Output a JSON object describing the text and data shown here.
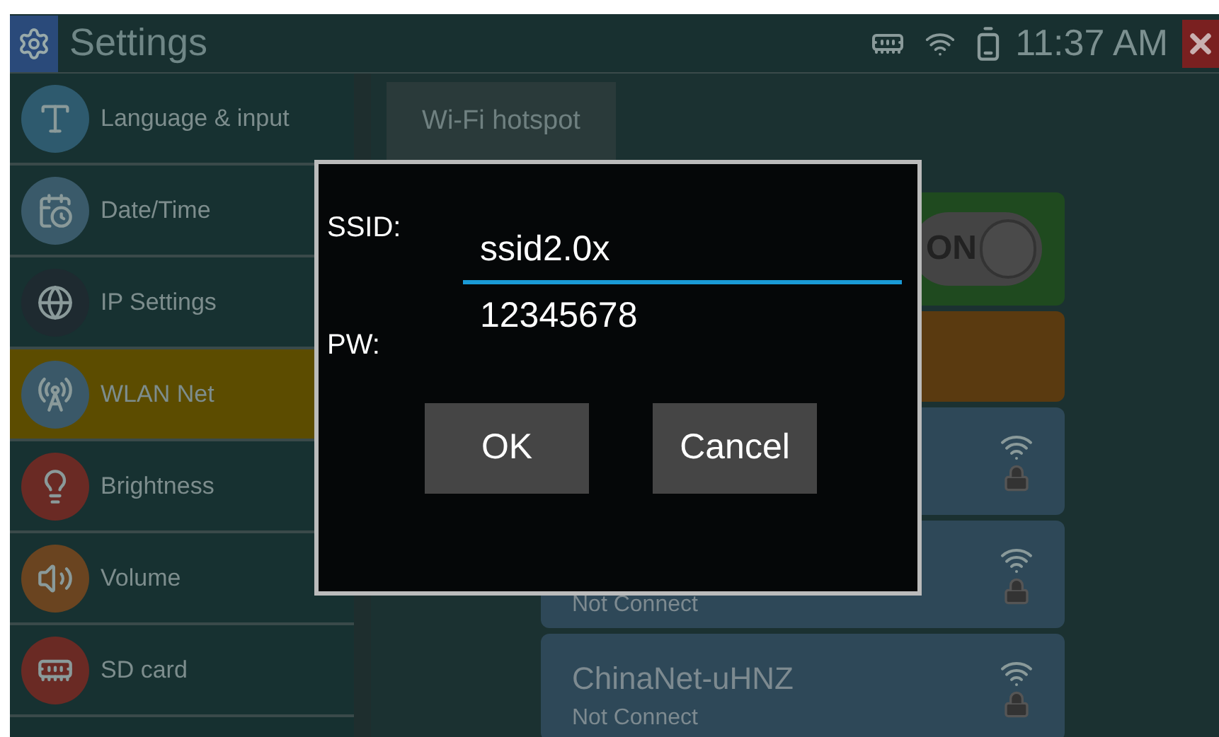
{
  "title_bar": {
    "title": "Settings",
    "time": "11:37 AM"
  },
  "sidebar": {
    "items": [
      {
        "label": "Language & input",
        "kind": "language",
        "selected": false
      },
      {
        "label": "Date/Time",
        "kind": "date",
        "selected": false
      },
      {
        "label": "IP Settings",
        "kind": "globe",
        "selected": false
      },
      {
        "label": "WLAN Net",
        "kind": "antenna",
        "selected": true
      },
      {
        "label": "Brightness",
        "kind": "bulb",
        "selected": false
      },
      {
        "label": "Volume",
        "kind": "speaker",
        "selected": false
      },
      {
        "label": "SD card",
        "kind": "sdcard",
        "selected": false
      }
    ]
  },
  "tabs": [
    {
      "label": "Wi-Fi hotspot",
      "selected": false
    }
  ],
  "wifi_switch": {
    "label": "ON",
    "on": true
  },
  "networks": [
    {
      "secured": true
    },
    {
      "status": "Not Connect",
      "secured": true
    },
    {
      "name": "ChinaNet-uHNZ",
      "status": "Not Connect",
      "secured": true
    }
  ],
  "dialog": {
    "ssid_label": "SSID:",
    "ssid_value": "ssid2.0x",
    "pw_label": "PW:",
    "pw_value": "12345678",
    "buttons": [
      "OK",
      "Cancel"
    ]
  }
}
